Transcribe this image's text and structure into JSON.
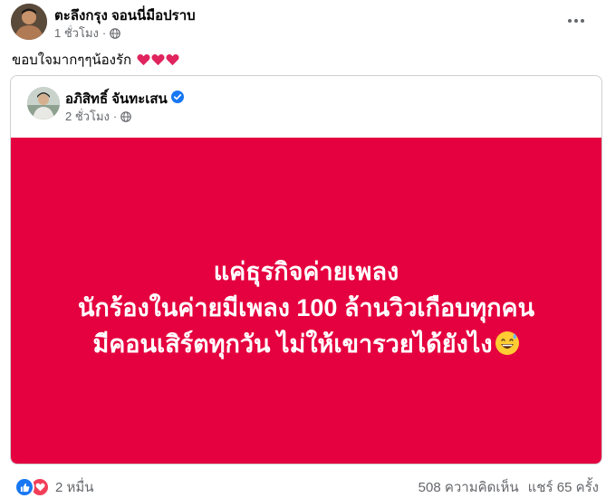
{
  "post": {
    "author_name": "ตะลึงกรุง จอนนี่มือปราบ",
    "time": "1 ชั่วโมง",
    "time_separator": "·",
    "caption": "ขอบใจมากๆๆน้องรัก",
    "caption_emoji": [
      "heart-emoji",
      "heart-emoji",
      "heart-emoji"
    ]
  },
  "shared_post": {
    "author_name": "อภิสิทธิ์ จันทะเสน",
    "verified": true,
    "time": "2 ชั่วโมง",
    "time_separator": "·",
    "image_text_lines": [
      "แค่ธุรกิจค่ายเพลง",
      "นักร้องในค่ายมีเพลง 100 ล้านวิวเกือบทุกคน",
      "มีคอนเสิร์ตทุกวัน ไม่ให้เขารวยได้ยังไง"
    ],
    "image_emoji": "grinning-sweat-emoji",
    "image_background": "#e5003f"
  },
  "footer": {
    "reaction_count": "2 หมื่น",
    "comments": "508 ความคิดเห็น",
    "shares": "แชร์ 65 ครั้ง"
  },
  "colors": {
    "like": "#1877f2",
    "love": "#f33e58",
    "verified": "#1877f2",
    "meta_text": "#65676b"
  }
}
